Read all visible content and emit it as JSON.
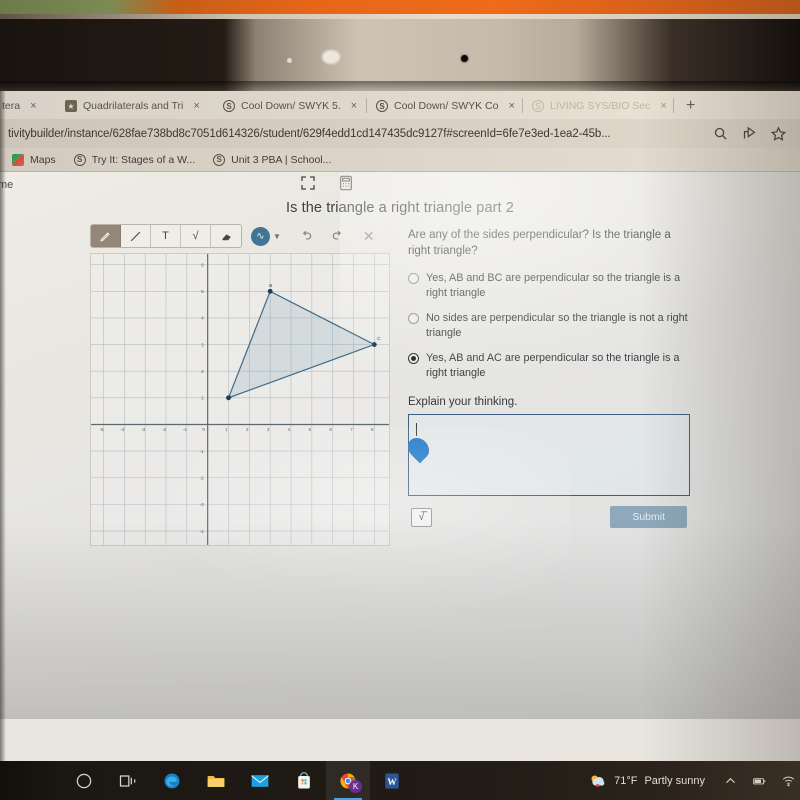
{
  "browser": {
    "tabs": [
      {
        "title": "tera",
        "favicon": "none",
        "state": "cut-off",
        "close_label": "×"
      },
      {
        "title": "Quadrilaterals and Tri",
        "favicon": "shield-icon",
        "state": "inactive",
        "close_label": "×"
      },
      {
        "title": "Cool Down/ SWYK 5.",
        "favicon": "schoology-icon",
        "state": "inactive",
        "close_label": "×"
      },
      {
        "title": "Cool Down/ SWYK Co",
        "favicon": "schoology-icon",
        "state": "active",
        "close_label": "×"
      },
      {
        "title": "LIVING SYS/BIO Sec",
        "favicon": "schoology-icon",
        "state": "faded",
        "close_label": "×"
      }
    ],
    "new_tab_label": "+",
    "url": "tivitybuilder/instance/628fae738bd8c7051d614326/student/629f4edd1cd147435dc9127f#screenId=6fe7e3ed-1ea2-45b...",
    "url_icons": [
      "search-icon",
      "share-icon",
      "star-icon"
    ],
    "bookmarks": [
      {
        "label": "Maps",
        "icon": "maps-icon"
      },
      {
        "label": "Try It: Stages of a W...",
        "icon": "schoology-icon"
      },
      {
        "label": "Unit 3 PBA | School...",
        "icon": "schoology-icon"
      }
    ]
  },
  "app": {
    "left_label": "me",
    "header_icons": [
      "fullscreen-icon",
      "calculator-icon"
    ],
    "title": "Is the triangle a right triangle part 2"
  },
  "drawing_toolbar": {
    "tools": [
      {
        "name": "pencil-tool",
        "glyph": "pencil",
        "selected": true
      },
      {
        "name": "line-tool",
        "glyph": "line",
        "selected": false
      },
      {
        "name": "text-tool",
        "glyph": "T",
        "selected": false
      },
      {
        "name": "math-tool",
        "glyph": "√",
        "selected": false
      },
      {
        "name": "eraser-tool",
        "glyph": "eraser",
        "selected": false
      }
    ],
    "color_swatch": "#3f7694",
    "color_glyph": "∿",
    "caret": "▼",
    "actions": [
      "undo-icon",
      "redo-icon",
      "close-icon"
    ],
    "close_glyph": "✕"
  },
  "graph": {
    "x_ticks": [
      "-5",
      "-4",
      "-3",
      "-2",
      "-1",
      "0",
      "1",
      "2",
      "3",
      "4",
      "5",
      "6",
      "7",
      "8"
    ],
    "y_ticks": [
      "6",
      "5",
      "4",
      "3",
      "2",
      "1",
      "-1",
      "-2",
      "-3",
      "-4"
    ],
    "xlim": [
      -5.6,
      8.8
    ],
    "ylim": [
      -4.6,
      6.4
    ],
    "points": [
      {
        "label": "A",
        "x": 1,
        "y": 1
      },
      {
        "label": "B",
        "x": 3,
        "y": 5
      },
      {
        "label": "C",
        "x": 8,
        "y": 3
      }
    ],
    "shape_color": "#3f6a88",
    "shape_fill": "rgba(110,150,175,0.18)"
  },
  "question": {
    "prompt": "Are any of the sides perpendicular?  Is the triangle a right triangle?",
    "choices": [
      {
        "label": "Yes, AB and BC are perpendicular so the triangle is a right triangle",
        "selected": false
      },
      {
        "label": "No sides are perpendicular so the triangle is not a right triangle",
        "selected": false
      },
      {
        "label": "Yes, AB and AC are perpendicular so the triangle is a right triangle",
        "selected": true
      }
    ],
    "explain_label": "Explain your thinking.",
    "answer_value": "",
    "math_button_glyph": "√̅",
    "submit_label": "Submit"
  },
  "taskbar": {
    "items": [
      {
        "name": "cortana-button",
        "icon": "circle-icon"
      },
      {
        "name": "task-view-button",
        "icon": "task-view-icon"
      },
      {
        "name": "edge-button",
        "icon": "edge-icon"
      },
      {
        "name": "file-explorer-button",
        "icon": "folder-icon"
      },
      {
        "name": "mail-button",
        "icon": "mail-icon"
      },
      {
        "name": "store-button",
        "icon": "store-icon"
      },
      {
        "name": "chrome-button",
        "icon": "chrome-icon",
        "badge": "K",
        "active": true
      },
      {
        "name": "word-button",
        "icon": "word-icon"
      }
    ],
    "weather": {
      "temperature": "71°F",
      "condition": "Partly sunny",
      "icon": "partly-sunny-icon"
    },
    "tray": [
      "chevron-up-icon",
      "battery-icon",
      "wifi-icon"
    ]
  }
}
